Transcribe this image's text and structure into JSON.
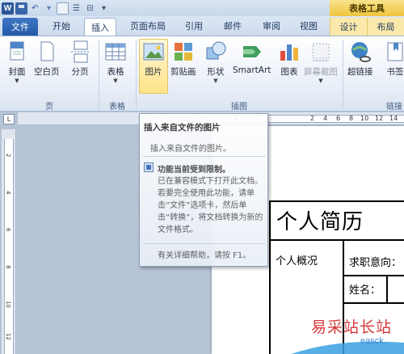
{
  "title_bar": {
    "contextual_tab_group": "表格工具"
  },
  "tabs": [
    {
      "label": "文件"
    },
    {
      "label": "开始"
    },
    {
      "label": "插入"
    },
    {
      "label": "页面布局"
    },
    {
      "label": "引用"
    },
    {
      "label": "邮件"
    },
    {
      "label": "审阅"
    },
    {
      "label": "视图"
    },
    {
      "label": "设计"
    },
    {
      "label": "布局"
    }
  ],
  "ribbon": {
    "groups": {
      "pages": "页",
      "tables": "表格",
      "illustrations": "插图",
      "links": "链接"
    },
    "buttons": {
      "cover": "封面",
      "blank_page": "空白页",
      "page_break": "分页",
      "table": "表格",
      "picture": "图片",
      "clip_art": "剪贴画",
      "shapes": "形状",
      "smartart": "SmartArt",
      "chart": "图表",
      "screenshot": "屏幕截图",
      "hyperlink": "超链接",
      "bookmark": "书签"
    }
  },
  "tooltip": {
    "title": "插入来自文件的图片",
    "description": "插入来自文件的图片。",
    "warning_title": "功能当前受到限制。",
    "warning_body": "已在兼容模式下打开此文档。若要完全使用此功能，请单击“文件”选项卡，然后单击“转换”，将文档转换为新的文件格式。",
    "help": "有关详细帮助，请按 F1。"
  },
  "ruler": {
    "h_numbers_left": [
      "4",
      "2"
    ],
    "h_numbers_right": [
      "2",
      "4",
      "6",
      "8",
      "10",
      "12",
      "14"
    ],
    "v_numbers": [
      "2",
      "4",
      "6",
      "8",
      "10",
      "12"
    ],
    "tab_selector": "L"
  },
  "document": {
    "title": "个人简历",
    "overview_label": "个人概况",
    "job_intent_label": "求职意向：",
    "name_label": "姓名："
  },
  "watermark": {
    "main": "易采站长站",
    "sub": "easck"
  }
}
